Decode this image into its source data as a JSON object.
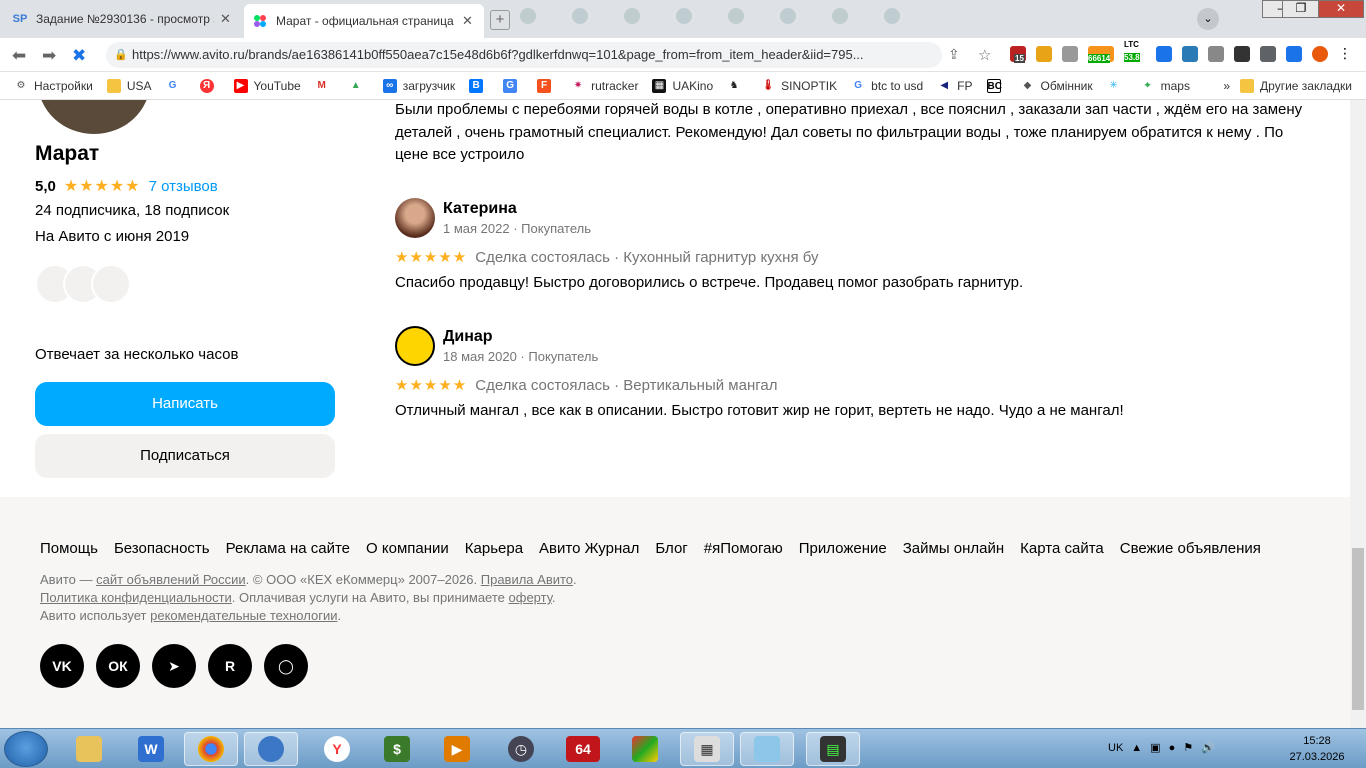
{
  "browser": {
    "tabs": [
      {
        "favicon": "SP",
        "title": "Задание №2930136 - просмотр з",
        "active": false
      },
      {
        "favicon": "avito-icon",
        "title": "Марат - официальная страница",
        "active": true
      }
    ],
    "url": "https://www.avito.ru/brands/ae16386141b0ff550aea7c15e48d6b6f?gdlkerfdnwq=101&page_from=from_item_header&iid=795...",
    "ext_badges": {
      "ext1": "15",
      "ltc_label": "LTC",
      "btc_value": "66614",
      "ltc_value": "53.8"
    },
    "bookmarks": [
      {
        "icon": "gear-icon",
        "label": "Настройки"
      },
      {
        "icon": "folder-icon",
        "label": "USA"
      },
      {
        "icon": "google-icon",
        "label": ""
      },
      {
        "icon": "yandex-icon",
        "label": ""
      },
      {
        "icon": "youtube-icon",
        "label": "YouTube"
      },
      {
        "icon": "gmail-icon",
        "label": ""
      },
      {
        "icon": "drive-icon",
        "label": ""
      },
      {
        "icon": "infinity-icon",
        "label": "загрузчик"
      },
      {
        "icon": "vk-icon",
        "label": ""
      },
      {
        "icon": "translate-icon",
        "label": ""
      },
      {
        "icon": "f-icon",
        "label": ""
      },
      {
        "icon": "rutracker-icon",
        "label": "rutracker"
      },
      {
        "icon": "uakino-icon",
        "label": "UAKino"
      },
      {
        "icon": "chess-icon",
        "label": ""
      },
      {
        "icon": "thermometer-icon",
        "label": "SINOPTIK"
      },
      {
        "icon": "google-icon",
        "label": "btc to usd"
      },
      {
        "icon": "fp-icon",
        "label": "FP"
      },
      {
        "icon": "bc-icon",
        "label": ""
      },
      {
        "icon": "exchange-icon",
        "label": "Обмінник"
      },
      {
        "icon": "star-icon",
        "label": ""
      },
      {
        "icon": "maps-icon",
        "label": "maps"
      }
    ],
    "more": "»",
    "other_bookmarks": "Другие закладки"
  },
  "profile": {
    "name": "Марат",
    "rating": "5,0",
    "stars": "★★★★★",
    "reviews_link": "7 отзывов",
    "subscribers": "24 подписчика, 18 подписок",
    "since": "На Авито с июня 2019",
    "replies": "Отвечает за несколько часов",
    "write_button": "Написать",
    "subscribe_button": "Подписаться"
  },
  "reviews": [
    {
      "text": "Были проблемы с перебоями горячей воды в котле , оперативно приехал , все пояснил , заказали зап части , ждём его на замену деталей , очень грамотный специалист. Рекомендую! Дал советы по фильтрации воды , тоже планируем обратится к нему . По цене все устроило"
    },
    {
      "name": "Катерина",
      "date": "1 мая 2022",
      "role": "Покупатель",
      "stars": "★★★★★",
      "deal": "Сделка состоялась",
      "item": "Кухонный гарнитур кухня бу",
      "text": "Спасибо продавцу! Быстро договорились о встрече. Продавец помог разобрать гарнитур."
    },
    {
      "name": "Динар",
      "date": "18 мая 2020",
      "role": "Покупатель",
      "stars": "★★★★★",
      "deal": "Сделка состоялась",
      "item": "Вертикальный мангал",
      "text": "Отличный мангал , все как в описании. Быстро готовит жир не горит, вертеть не надо. Чудо а не мангал!"
    }
  ],
  "footer": {
    "links": [
      "Помощь",
      "Безопасность",
      "Реклама на сайте",
      "О компании",
      "Карьера",
      "Авито Журнал",
      "Блог",
      "#яПомогаю",
      "Приложение",
      "Займы онлайн",
      "Карта сайта",
      "Свежие объявления"
    ],
    "line1_a": "Авито — ",
    "line1_link1": "сайт объявлений России",
    "line1_b": ". © ООО «КЕХ еКоммерц» 2007–2026. ",
    "line1_link2": "Правила Авито",
    "line1_c": ".",
    "line2_link1": "Политика конфиденциальности",
    "line2_b": ". Оплачивая услуги на Авито, вы принимаете ",
    "line2_link2": "оферту",
    "line2_c": ".",
    "line3_a": "Авито использует ",
    "line3_link": "рекомендательные технологии",
    "line3_c": ".",
    "social": [
      {
        "icon": "vk-icon",
        "glyph": "VK"
      },
      {
        "icon": "ok-icon",
        "glyph": "ОК"
      },
      {
        "icon": "telegram-icon",
        "glyph": "➤"
      },
      {
        "icon": "rutube-icon",
        "glyph": "R"
      },
      {
        "icon": "chat-icon",
        "glyph": "◯"
      }
    ]
  },
  "taskbar": {
    "lang": "UK",
    "time": "15:28",
    "date": "27.03.2026",
    "icon64": "64"
  }
}
